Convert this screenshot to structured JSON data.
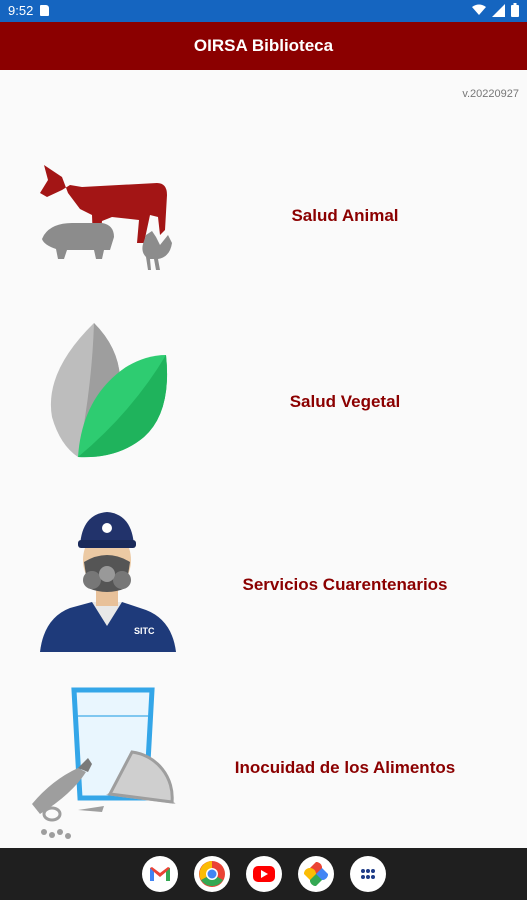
{
  "status_bar": {
    "time": "9:52",
    "icons": [
      "sd-card-icon",
      "wifi-icon",
      "signal-icon",
      "battery-icon"
    ]
  },
  "app_bar": {
    "title": "OIRSA Biblioteca"
  },
  "version": "v.20220927",
  "menu": [
    {
      "label": "Salud Animal",
      "icon": "farm-animals-icon"
    },
    {
      "label": "Salud Vegetal",
      "icon": "leaf-icon"
    },
    {
      "label": "Servicios Cuarentenarios",
      "icon": "quarantine-inspector-icon"
    },
    {
      "label": "Inocuidad de los Alimentos",
      "icon": "food-safety-icon"
    }
  ],
  "nav_bar": {
    "apps": [
      "gmail-icon",
      "chrome-icon",
      "youtube-icon",
      "photos-icon",
      "app-drawer-icon"
    ]
  },
  "colors": {
    "status_bar": "#1565c0",
    "app_bar": "#8b0000",
    "label": "#8b0000",
    "leaf_green": "#2ecc71",
    "nav_bar": "#1f1f1f"
  }
}
